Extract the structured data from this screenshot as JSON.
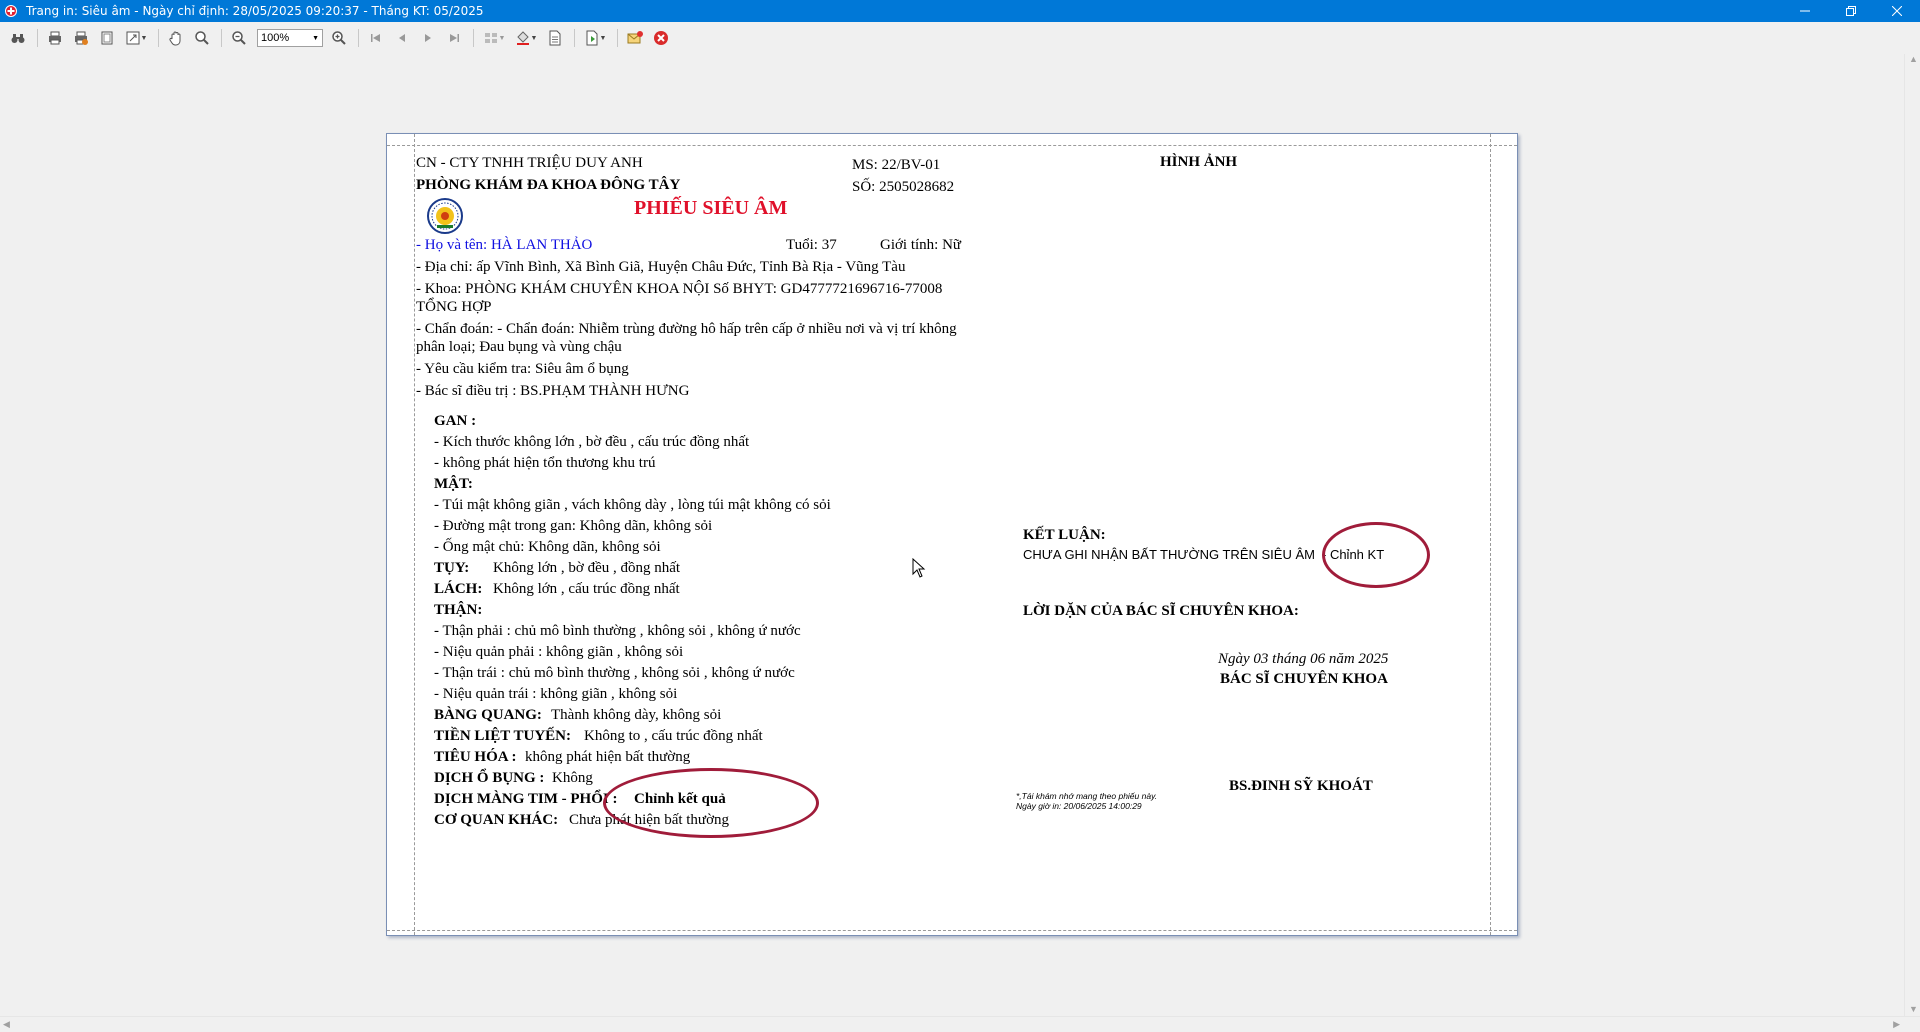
{
  "window": {
    "title": "Trang in: Siêu âm - Ngày chỉ định: 28/05/2025 09:20:37 - Tháng KT: 05/2025"
  },
  "toolbar": {
    "zoom_value": "100%"
  },
  "report": {
    "company": "CN - CTY TNHH TRIỆU DUY ANH",
    "clinic": "PHÒNG KHÁM ĐA KHOA ĐÔNG TÂY",
    "ms": "MS: 22/BV-01",
    "so": "SỐ: 2505028682",
    "title": "PHIẾU SIÊU ÂM",
    "image_header": "HÌNH ẢNH",
    "patient_name": "- Họ và tên: HÀ LAN THẢO",
    "age": "Tuổi: 37",
    "gender": "Giới tính: Nữ",
    "address": "- Địa chỉ: ấp Vĩnh Bình, Xã Bình Giã, Huyện Châu Đức, Tỉnh Bà Rịa - Vũng Tàu",
    "department_line1": "- Khoa: PHÒNG KHÁM CHUYÊN KHOA NỘI  Số BHYT: GD4777721696716-77008",
    "department_line2": "TỔNG HỢP",
    "diagnosis_line1": "- Chẩn đoán: - Chẩn đoán: Nhiễm trùng đường hô hấp trên cấp ở nhiều nơi và vị trí không",
    "diagnosis_line2": "phân loại; Đau bụng và vùng chậu",
    "request": "- Yêu cầu kiểm tra: Siêu âm ổ bụng",
    "doctor": "- Bác sĩ điều trị : BS.PHẠM THÀNH HƯNG",
    "findings": {
      "gan_heading": "GAN :",
      "gan_1": "- Kích thước không lớn , bờ đều , cấu trúc đồng nhất",
      "gan_2": "- không phát hiện tổn thương khu trú",
      "mat_heading": "MẬT:",
      "mat_1": "- Túi mật không giãn , vách không dày , lòng túi mật không có sỏi",
      "mat_2": "- Đường mật trong gan: Không dãn, không sỏi",
      "mat_3": "- Ống mật chủ:  Không dãn, không sỏi",
      "tuy_label": "TỤY:",
      "tuy_value": "Không lớn , bờ đều , đồng nhất",
      "lach_label": "LÁCH:",
      "lach_value": "Không lớn , cấu trúc đồng nhất",
      "than_heading": "THẬN:",
      "than_1": "- Thận phải : chủ mô bình thường , không sỏi , không ứ nước",
      "than_2": "- Niệu quản phải : không giãn , không sỏi",
      "than_3": "- Thận trái : chủ mô bình thường , không sỏi , không ứ nước",
      "than_4": "- Niệu quản trái : không giãn , không sỏi",
      "bang_quang_label": "BÀNG QUANG:",
      "bang_quang_value": "Thành không dày, không sỏi",
      "tien_liet_label": "TIỀN LIỆT TUYẾN:",
      "tien_liet_value": "Không to , cấu trúc đồng nhất",
      "tieu_hoa_label": "TIÊU HÓA :",
      "tieu_hoa_value": "không phát hiện bất thường",
      "dich_o_bung_label": "DỊCH Ổ BỤNG :",
      "dich_o_bung_value": "Không",
      "dich_mang_tim_label": "DỊCH MÀNG TIM - PHỔI :",
      "dich_mang_tim_value": "Chỉnh kết quả",
      "co_quan_khac_label": "CƠ QUAN KHÁC:",
      "co_quan_khac_value": "Chưa phát hiện bất thường"
    },
    "conclusion_heading": "KẾT LUẬN:",
    "conclusion_text": "CHƯA GHI NHẬN BẤT THƯỜNG TRÊN SIÊU ÂM",
    "conclusion_edit": "- Chỉnh  KT",
    "advice_heading": "LỜI DẶN CỦA BÁC SĨ CHUYÊN KHOA:",
    "date_line": "Ngày 03 tháng 06 năm 2025",
    "specialist_title": "BÁC SĨ CHUYÊN KHOA",
    "specialist_name": "BS.ĐINH SỸ KHOÁT",
    "footnote_1": "*,Tái khám nhớ mang theo phiếu này.",
    "footnote_2": "Ngày giờ in: 20/06/2025 14:00:29"
  },
  "colors": {
    "titlebar": "#0078d7",
    "title_red": "#e0102a",
    "patient_blue": "#1010e0",
    "annotation_ellipse": "#a01c3a"
  }
}
